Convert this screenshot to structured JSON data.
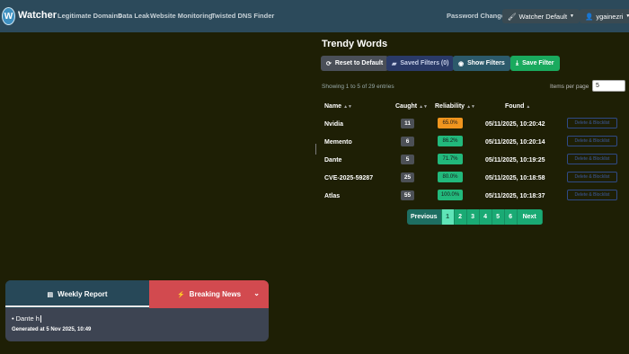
{
  "app": {
    "logo_letter": "W",
    "name": "Watcher"
  },
  "nav": {
    "links": [
      "Legitimate Domains",
      "Data Leak",
      "Website Monitoring",
      "Twisted DNS Finder"
    ],
    "password_change": "Password Change",
    "theme_label": "Watcher Default",
    "user_label": "ygainezri"
  },
  "trendy": {
    "title": "Trendy Words",
    "buttons": {
      "reset": "Reset to Default",
      "saved_filters": "Saved Filters (0)",
      "show_filters": "Show Filters",
      "save_filter": "Save Filter"
    },
    "entries_info": "Showing 1 to 5 of 29 entries",
    "items_per_page_label": "Items per page",
    "items_per_page_value": "5",
    "columns": {
      "name": "Name",
      "caught": "Caught",
      "reliability": "Reliability",
      "found": "Found"
    },
    "rows": [
      {
        "name": "Nvidia",
        "caught": "11",
        "reliability": "65.0%",
        "rel_color": "#f0951e",
        "found": "05/11/2025, 10:20:42",
        "action": "Delete & Blocklist"
      },
      {
        "name": "Memento",
        "caught": "6",
        "reliability": "86.2%",
        "rel_color": "#22b97c",
        "found": "05/11/2025, 10:20:14",
        "action": "Delete & Blocklist"
      },
      {
        "name": "Dante",
        "caught": "5",
        "reliability": "71.7%",
        "rel_color": "#22b97c",
        "found": "05/11/2025, 10:19:25",
        "action": "Delete & Blocklist"
      },
      {
        "name": "CVE-2025-59287",
        "caught": "25",
        "reliability": "80.0%",
        "rel_color": "#22b97c",
        "found": "05/11/2025, 10:18:58",
        "action": "Delete & Blocklist"
      },
      {
        "name": "Atlas",
        "caught": "55",
        "reliability": "100.0%",
        "rel_color": "#22b97c",
        "found": "05/11/2025, 10:18:37",
        "action": "Delete & Blocklist"
      }
    ],
    "pagination": {
      "previous": "Previous",
      "pages": [
        "1",
        "2",
        "3",
        "4",
        "5",
        "6"
      ],
      "active_page": "1",
      "next": "Next"
    }
  },
  "news": {
    "weekly_tab": "Weekly Report",
    "breaking_tab": "Breaking News",
    "item_text": "Dante h",
    "generated": "Generated at 5 Nov 2025, 10:49"
  }
}
